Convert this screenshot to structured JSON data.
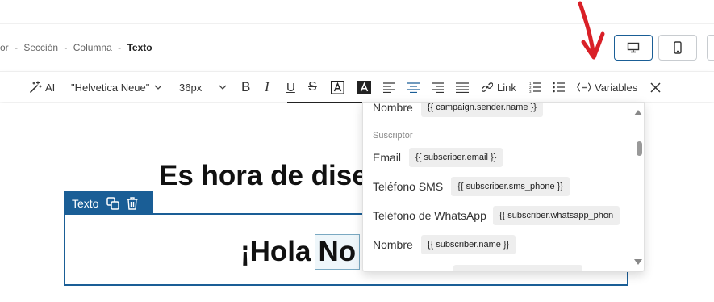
{
  "breadcrumb": {
    "item1": "or",
    "item2": "Sección",
    "item3": "Columna",
    "current": "Texto",
    "separator": "-"
  },
  "device_buttons": [
    {
      "icon": "desktop-icon",
      "active": true
    },
    {
      "icon": "mobile-icon",
      "active": false
    }
  ],
  "annotation": {
    "icon": "red-arrow-down-icon",
    "color": "#d92027"
  },
  "toolbar": {
    "ai_label": "AI",
    "font_family": "\"Helvetica Neue\"",
    "font_size": "36px",
    "link_label": "Link",
    "variables_label": "Variables",
    "icons": [
      "magic-wand-icon",
      "chevron-down-icon",
      "bold-icon",
      "italic-icon",
      "underline-icon",
      "strikethrough-icon",
      "text-color-icon",
      "background-color-icon",
      "align-left-icon",
      "align-center-icon",
      "align-right-icon",
      "align-justify-icon",
      "link-icon",
      "numbered-list-icon",
      "bulleted-list-icon",
      "variables-icon",
      "close-icon"
    ]
  },
  "canvas": {
    "heading": "Es hora de dise",
    "block_label": "Texto",
    "greeting_text": "¡Hola",
    "greeting_selected": "No"
  },
  "variables_dropdown": {
    "top_row": {
      "label": "Nombre",
      "chip": "{{ campaign.sender.name }}"
    },
    "section": "Suscriptor",
    "rows": [
      {
        "label": "Email",
        "chip": "{{ subscriber.email }}"
      },
      {
        "label": "Teléfono SMS",
        "chip": "{{ subscriber.sms_phone }}"
      },
      {
        "label": "Teléfono de WhatsApp",
        "chip": "{{ subscriber.whatsapp_phon"
      },
      {
        "label": "Nombre",
        "chip": "{{ subscriber.name }}"
      }
    ]
  },
  "colors": {
    "accent": "#1a5e96",
    "chip_bg": "#eeeeee"
  }
}
